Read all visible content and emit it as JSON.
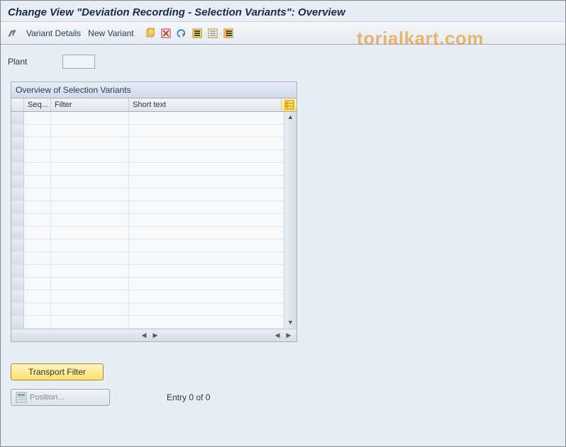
{
  "title": "Change View \"Deviation Recording - Selection Variants\": Overview",
  "toolbar": {
    "variant_details": "Variant Details",
    "new_variant": "New Variant"
  },
  "watermark": "torialkart.com",
  "form": {
    "plant_label": "Plant",
    "plant_value": ""
  },
  "grid": {
    "title": "Overview of Selection Variants",
    "columns": {
      "seq": "Seq...",
      "filter": "Filter",
      "short": "Short text"
    },
    "row_count": 17
  },
  "buttons": {
    "transport_filter": "Transport Filter",
    "position": "Position..."
  },
  "footer": {
    "entry_text": "Entry 0 of 0"
  },
  "chart_data": {
    "type": "table",
    "title": "Overview of Selection Variants",
    "columns": [
      "Seq...",
      "Filter",
      "Short text"
    ],
    "rows": []
  }
}
